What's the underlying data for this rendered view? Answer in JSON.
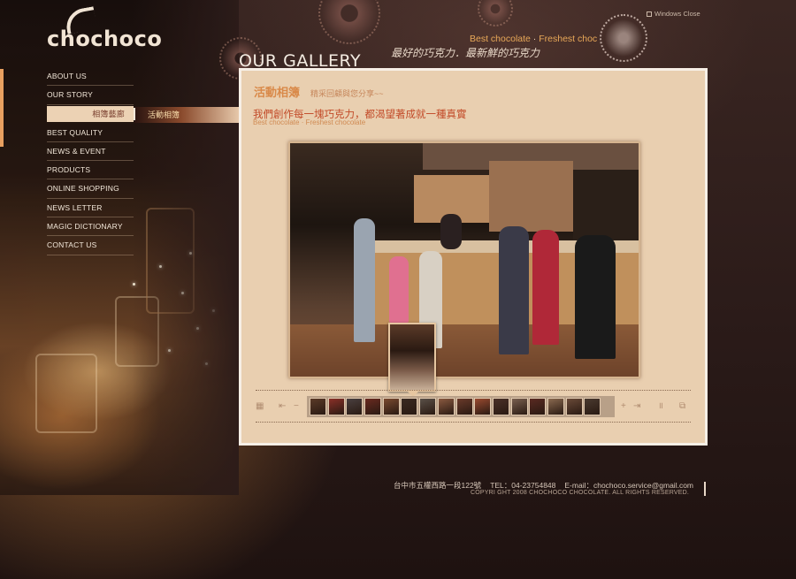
{
  "brand": {
    "logo_text": "chochoco"
  },
  "window": {
    "close_label": "Windows Close"
  },
  "header": {
    "title": "OUR GALLERY",
    "tagline_en_primary": "Best chocolate",
    "tagline_en_sep": " · ",
    "tagline_en_secondary": "Freshest choc",
    "tagline_zh": "最好的巧克力．最新鮮的巧克力"
  },
  "nav": {
    "items": [
      {
        "label": "ABOUT US"
      },
      {
        "label": "OUR STORY"
      },
      {
        "label": "相簿藝廊",
        "active": true
      },
      {
        "label": "BEST QUALITY"
      },
      {
        "label": "NEWS & EVENT"
      },
      {
        "label": "PRODUCTS"
      },
      {
        "label": "ONLINE SHOPPING"
      },
      {
        "label": "NEWS LETTER"
      },
      {
        "label": "MAGIC DICTIONARY"
      },
      {
        "label": "CONTACT US"
      }
    ],
    "subnav_item": "活動相簿"
  },
  "panel": {
    "title": "活動相簿",
    "subtitle": "精采回顧與您分享~~",
    "heading": "我們創作每一塊巧克力，都渴望著成就一種真實",
    "small_en": "Best chocolate · Freshest chocolate"
  },
  "gallery": {
    "thumb_count": 16,
    "controls": {
      "grid": "▦",
      "first": "⇤",
      "minus": "−",
      "plus": "+",
      "last": "⇥",
      "pause": "॥",
      "fullscreen": "⧉"
    }
  },
  "footer": {
    "address": "台中市五權西路一段122號",
    "tel": "TEL：04-23754848",
    "email": "E-mail：chochoco.service@gmail.com",
    "copyright": "COPYRI GHT 2008 CHOCHOCO CHOCOLATE. ALL RIGHTS RESERVED."
  },
  "colors": {
    "accent_orange": "#e8a858",
    "panel_bg": "#e9cfb0",
    "heading_red": "#c24a28",
    "page_bg": "#2a1a18"
  }
}
